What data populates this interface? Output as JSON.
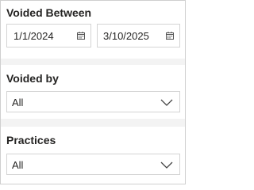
{
  "voided_between": {
    "title": "Voided Between",
    "from_value": "1/1/2024",
    "to_value": "3/10/2025",
    "icon": "calendar-icon"
  },
  "voided_by": {
    "title": "Voided by",
    "selected": "All",
    "icon": "chevron-down-icon"
  },
  "practices": {
    "title": "Practices",
    "selected": "All",
    "icon": "chevron-down-icon"
  },
  "colors": {
    "panel_gap": "#f3f3f3",
    "border": "#d4d4d4",
    "text": "#252423"
  }
}
